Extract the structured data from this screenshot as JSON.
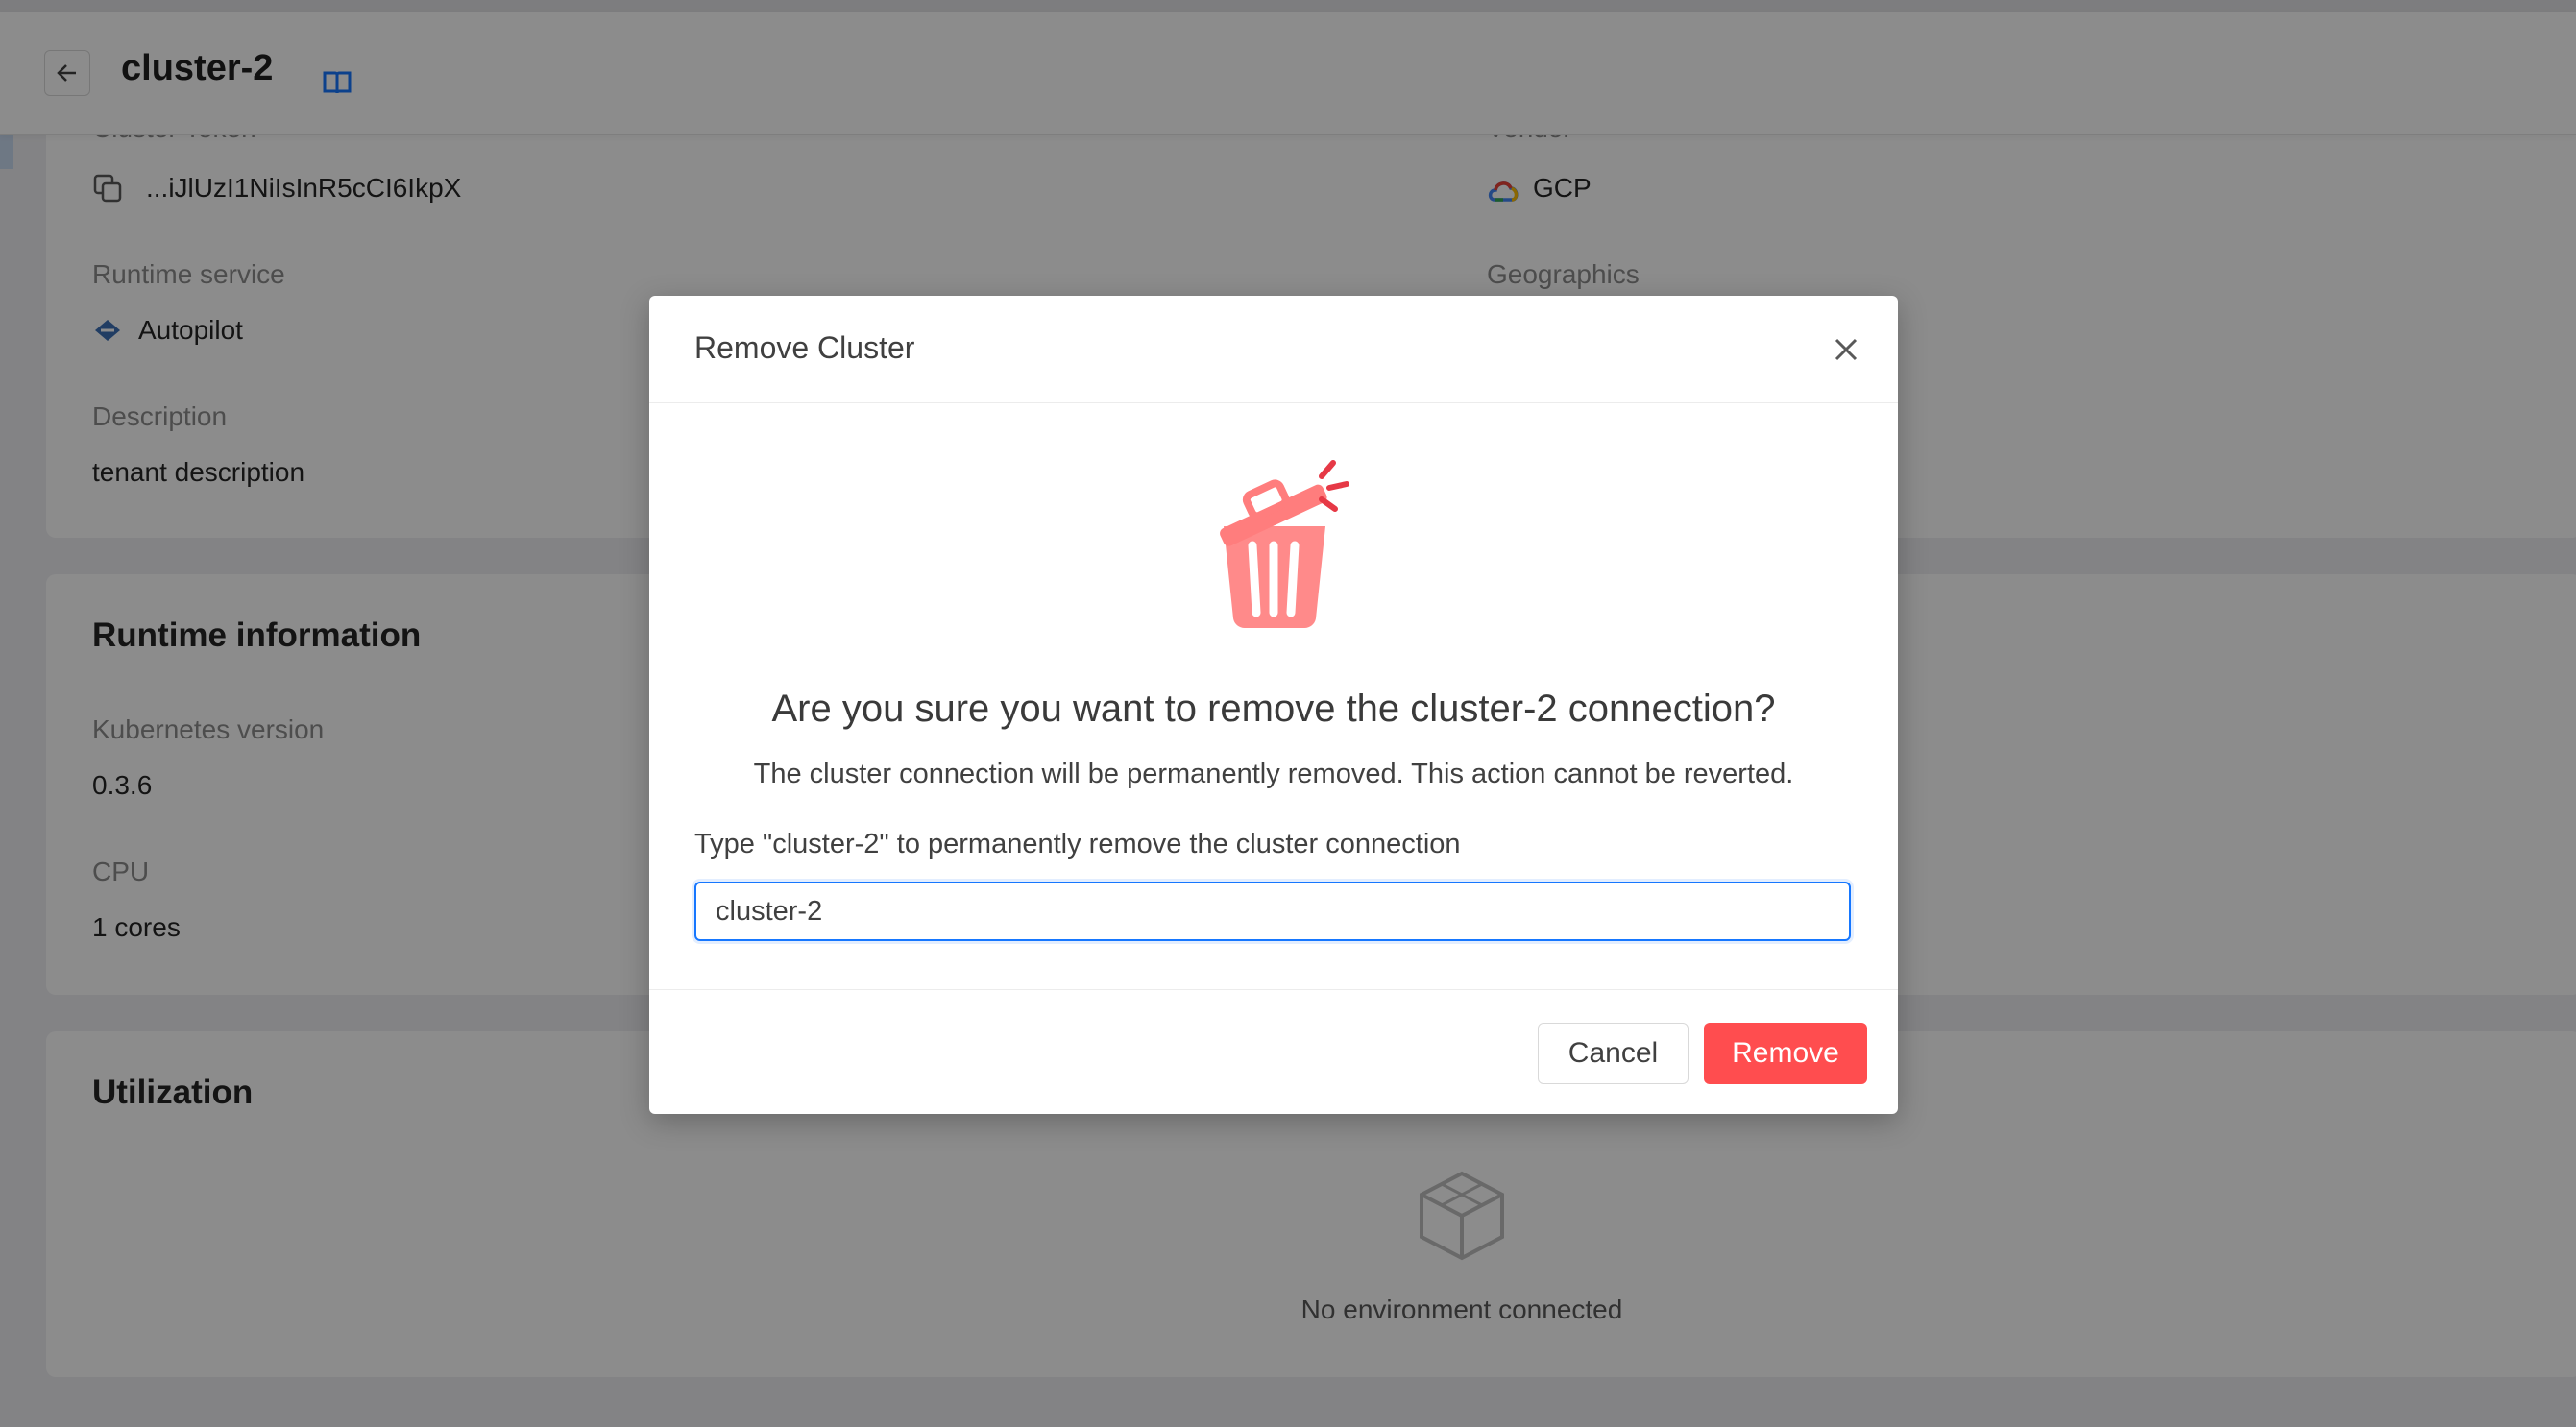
{
  "header": {
    "title": "cluster-2"
  },
  "details": {
    "token_label": "Cluster Token",
    "token_value": "...iJlUzI1NiIsInR5cCI6IkpX",
    "vendor_label": "Vendor",
    "vendor_value": "GCP",
    "runtime_label": "Runtime service",
    "runtime_value": "Autopilot",
    "geo_label": "Geographics",
    "description_label": "Description",
    "description_value": "tenant description"
  },
  "runtime": {
    "title": "Runtime information",
    "k8s_label": "Kubernetes version",
    "k8s_value": "0.3.6",
    "cpu_label": "CPU",
    "cpu_value": "1 cores"
  },
  "utilization": {
    "title": "Utilization",
    "empty_text": "No environment connected"
  },
  "modal": {
    "title": "Remove Cluster",
    "question": "Are you sure you want to remove the cluster-2 connection?",
    "warning": "The cluster connection will be permanently removed. This action cannot be reverted.",
    "confirm_label": "Type \"cluster-2\" to permanently remove the cluster connection",
    "input_value": "cluster-2",
    "cancel_label": "Cancel",
    "remove_label": "Remove"
  },
  "colors": {
    "danger": "#ff4d4f",
    "focus": "#1677ff",
    "trash": "#ff8a8a"
  },
  "icons": [
    "back-arrow-icon",
    "book-icon",
    "copy-icon",
    "gcp-cloud-icon",
    "autopilot-icon",
    "trash-icon",
    "close-icon",
    "empty-box-icon"
  ]
}
